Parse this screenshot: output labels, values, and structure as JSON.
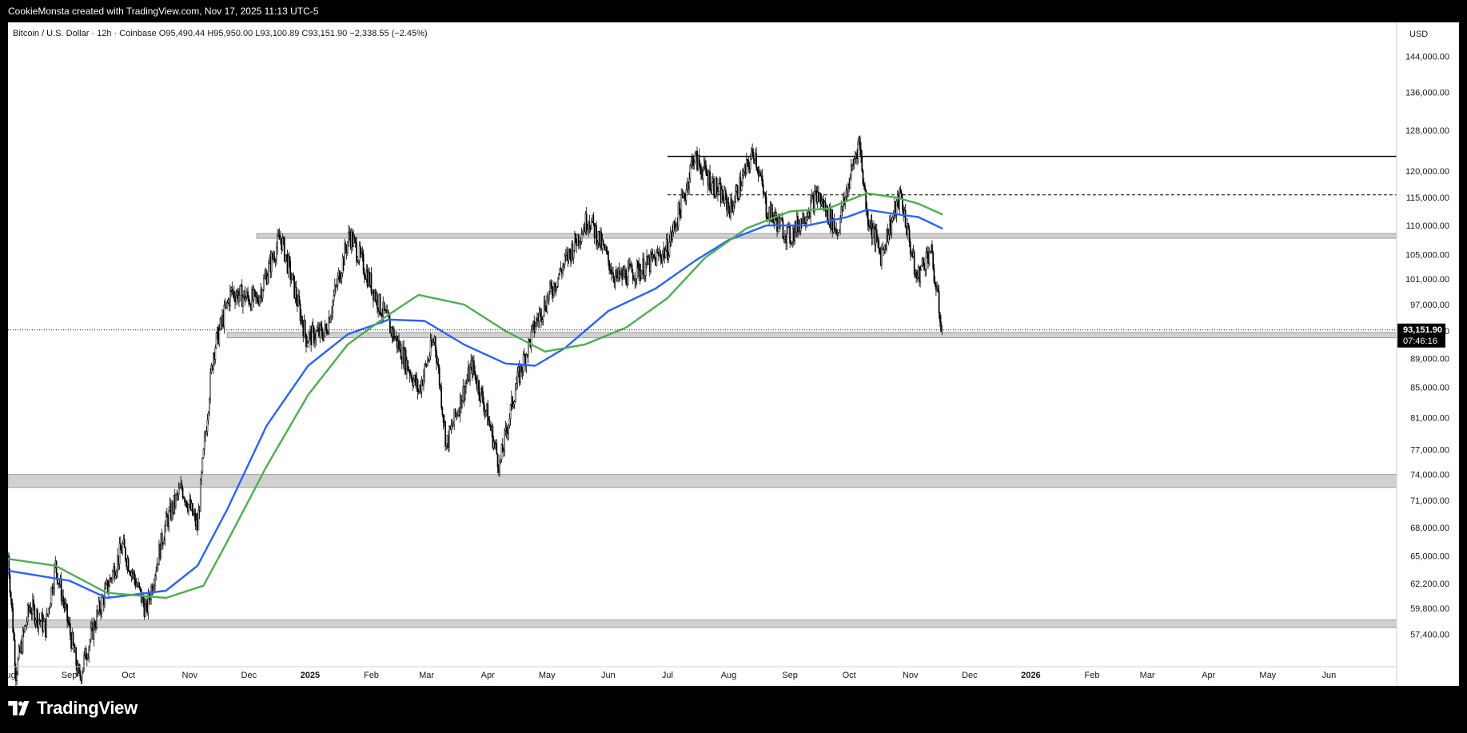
{
  "attribution": "CookieMonsta created with TradingView.com, Nov 17, 2025 11:13 UTC-5",
  "branding": {
    "logo_text": "TradingView",
    "logo_icon": "tradingview-logo-icon"
  },
  "chart_data": {
    "type": "candlestick",
    "symbol": "Bitcoin / U.S. Dollar",
    "interval": "12h",
    "exchange": "Coinbase",
    "ohlc_header": "Bitcoin / U.S. Dollar · 12h · Coinbase  O95,490.44  H95,950.00  L93,100.89  C93,151.90  −2,338.55 (−2.45%)",
    "open": 95490.44,
    "high": 95950.0,
    "low": 93100.89,
    "close": 93151.9,
    "change": -2338.55,
    "change_percent": -2.45,
    "currency_label": "USD",
    "price_axis": {
      "log_scale": true,
      "range": [
        54500,
        152000
      ],
      "ticks": [
        144000,
        136000,
        128000,
        120000,
        115000,
        110000,
        105000,
        101000,
        97000,
        93000,
        89000,
        85000,
        81000,
        77000,
        74000,
        71000,
        68000,
        65000,
        62200,
        59800,
        57400
      ],
      "tick_labels": [
        "144,000.00",
        "136,000.00",
        "128,000.00",
        "120,000.00",
        "115,000.00",
        "110,000.00",
        "105,000.00",
        "101,000.00",
        "97,000.00",
        "93,000.00",
        "89,000.00",
        "85,000.00",
        "81,000.00",
        "77,000.00",
        "74,000.00",
        "71,000.00",
        "68,000.00",
        "65,000.00",
        "62,200.00",
        "59,800.00",
        "57,400.00"
      ]
    },
    "time_axis": {
      "range": [
        "2024-08-01",
        "2026-06-30"
      ],
      "ticks": [
        {
          "date": "2024-08-01",
          "label": "Aug",
          "bold": false
        },
        {
          "date": "2024-09-01",
          "label": "Sep",
          "bold": false
        },
        {
          "date": "2024-10-01",
          "label": "Oct",
          "bold": false
        },
        {
          "date": "2024-11-01",
          "label": "Nov",
          "bold": false
        },
        {
          "date": "2024-12-01",
          "label": "Dec",
          "bold": false
        },
        {
          "date": "2025-01-01",
          "label": "2025",
          "bold": true
        },
        {
          "date": "2025-02-01",
          "label": "Feb",
          "bold": false
        },
        {
          "date": "2025-03-01",
          "label": "Mar",
          "bold": false
        },
        {
          "date": "2025-04-01",
          "label": "Apr",
          "bold": false
        },
        {
          "date": "2025-05-01",
          "label": "May",
          "bold": false
        },
        {
          "date": "2025-06-01",
          "label": "Jun",
          "bold": false
        },
        {
          "date": "2025-07-01",
          "label": "Jul",
          "bold": false
        },
        {
          "date": "2025-08-01",
          "label": "Aug",
          "bold": false
        },
        {
          "date": "2025-09-01",
          "label": "Sep",
          "bold": false
        },
        {
          "date": "2025-10-01",
          "label": "Oct",
          "bold": false
        },
        {
          "date": "2025-11-01",
          "label": "Nov",
          "bold": false
        },
        {
          "date": "2025-12-01",
          "label": "Dec",
          "bold": false
        },
        {
          "date": "2026-01-01",
          "label": "2026",
          "bold": true
        },
        {
          "date": "2026-02-01",
          "label": "Feb",
          "bold": false
        },
        {
          "date": "2026-03-01",
          "label": "Mar",
          "bold": false
        },
        {
          "date": "2026-04-01",
          "label": "Apr",
          "bold": false
        },
        {
          "date": "2026-05-01",
          "label": "May",
          "bold": false
        },
        {
          "date": "2026-06-01",
          "label": "Jun",
          "bold": false
        }
      ]
    },
    "current_price": {
      "value": 93151.9,
      "label": "93,151.90",
      "countdown": "07:46:16"
    },
    "price_path": [
      [
        "2024-08-01",
        65000
      ],
      [
        "2024-08-05",
        54000
      ],
      [
        "2024-08-12",
        60000
      ],
      [
        "2024-08-20",
        58000
      ],
      [
        "2024-08-25",
        64000
      ],
      [
        "2024-09-06",
        53500
      ],
      [
        "2024-09-15",
        59000
      ],
      [
        "2024-09-28",
        66000
      ],
      [
        "2024-10-10",
        59500
      ],
      [
        "2024-10-20",
        68500
      ],
      [
        "2024-10-28",
        72500
      ],
      [
        "2024-11-05",
        68000
      ],
      [
        "2024-11-13",
        90000
      ],
      [
        "2024-11-22",
        99000
      ],
      [
        "2024-12-05",
        97500
      ],
      [
        "2024-12-17",
        108000
      ],
      [
        "2024-12-30",
        92000
      ],
      [
        "2025-01-09",
        93000
      ],
      [
        "2025-01-21",
        108500
      ],
      [
        "2025-02-05",
        97000
      ],
      [
        "2025-02-25",
        84500
      ],
      [
        "2025-03-05",
        92000
      ],
      [
        "2025-03-11",
        77500
      ],
      [
        "2025-03-24",
        88000
      ],
      [
        "2025-03-31",
        82000
      ],
      [
        "2025-04-07",
        75000
      ],
      [
        "2025-04-15",
        85000
      ],
      [
        "2025-04-25",
        94000
      ],
      [
        "2025-05-09",
        103000
      ],
      [
        "2025-05-22",
        111500
      ],
      [
        "2025-06-05",
        101000
      ],
      [
        "2025-06-20",
        103000
      ],
      [
        "2025-07-01",
        106000
      ],
      [
        "2025-07-10",
        116000
      ],
      [
        "2025-07-14",
        122800
      ],
      [
        "2025-07-25",
        117000
      ],
      [
        "2025-08-02",
        113000
      ],
      [
        "2025-08-14",
        124000
      ],
      [
        "2025-08-20",
        113000
      ],
      [
        "2025-09-01",
        108000
      ],
      [
        "2025-09-15",
        115500
      ],
      [
        "2025-09-25",
        109000
      ],
      [
        "2025-10-01",
        118000
      ],
      [
        "2025-10-06",
        126000
      ],
      [
        "2025-10-10",
        112000
      ],
      [
        "2025-10-17",
        105000
      ],
      [
        "2025-10-27",
        115500
      ],
      [
        "2025-11-04",
        101000
      ],
      [
        "2025-11-11",
        106000
      ],
      [
        "2025-11-17",
        93151.9
      ]
    ],
    "indicators": [
      {
        "color": "#2962ff",
        "points": [
          [
            "2024-08-01",
            63500
          ],
          [
            "2024-09-01",
            62500
          ],
          [
            "2024-09-20",
            60800
          ],
          [
            "2024-10-20",
            61500
          ],
          [
            "2024-11-05",
            64000
          ],
          [
            "2024-11-20",
            70000
          ],
          [
            "2024-12-10",
            80000
          ],
          [
            "2024-12-31",
            88000
          ],
          [
            "2025-01-20",
            92500
          ],
          [
            "2025-02-10",
            94700
          ],
          [
            "2025-02-28",
            94500
          ],
          [
            "2025-03-20",
            91000
          ],
          [
            "2025-04-10",
            88300
          ],
          [
            "2025-04-25",
            88000
          ],
          [
            "2025-05-10",
            90500
          ],
          [
            "2025-06-01",
            96000
          ],
          [
            "2025-06-25",
            99500
          ],
          [
            "2025-07-15",
            104000
          ],
          [
            "2025-08-01",
            107500
          ],
          [
            "2025-08-20",
            110000
          ],
          [
            "2025-09-10",
            110000
          ],
          [
            "2025-09-30",
            111500
          ],
          [
            "2025-10-10",
            112800
          ],
          [
            "2025-10-25",
            112000
          ],
          [
            "2025-11-05",
            111500
          ],
          [
            "2025-11-17",
            109500
          ]
        ]
      },
      {
        "color": "#4caf50",
        "points": [
          [
            "2024-08-01",
            64700
          ],
          [
            "2024-08-25",
            64000
          ],
          [
            "2024-09-20",
            61300
          ],
          [
            "2024-10-20",
            60800
          ],
          [
            "2024-11-08",
            62000
          ],
          [
            "2024-11-20",
            66500
          ],
          [
            "2024-12-10",
            75000
          ],
          [
            "2024-12-31",
            84000
          ],
          [
            "2025-01-20",
            91000
          ],
          [
            "2025-02-10",
            95500
          ],
          [
            "2025-02-25",
            98500
          ],
          [
            "2025-03-20",
            97000
          ],
          [
            "2025-04-10",
            93000
          ],
          [
            "2025-04-30",
            90000
          ],
          [
            "2025-05-20",
            91000
          ],
          [
            "2025-06-10",
            93500
          ],
          [
            "2025-07-01",
            98000
          ],
          [
            "2025-07-20",
            104500
          ],
          [
            "2025-08-10",
            109500
          ],
          [
            "2025-09-01",
            112500
          ],
          [
            "2025-09-20",
            113000
          ],
          [
            "2025-10-10",
            115800
          ],
          [
            "2025-10-25",
            115000
          ],
          [
            "2025-11-05",
            113900
          ],
          [
            "2025-11-17",
            112000
          ]
        ]
      }
    ],
    "horizontal_levels": [
      {
        "kind": "line",
        "style": "solid",
        "price": 122800,
        "from": "2025-07-01"
      },
      {
        "kind": "line",
        "style": "dashed",
        "price": 115500,
        "from": "2025-07-01"
      },
      {
        "kind": "zone",
        "from_price": 107800,
        "to_price": 108600,
        "from": "2024-12-05"
      },
      {
        "kind": "zone",
        "from_price": 92000,
        "to_price": 92800,
        "from": "2024-11-20"
      },
      {
        "kind": "zone",
        "from_price": 72500,
        "to_price": 74000,
        "from": "2024-08-01"
      },
      {
        "kind": "zone",
        "from_price": 58000,
        "to_price": 58700,
        "from": "2024-08-01"
      }
    ],
    "colors": {
      "candles": "#000000",
      "zone_fill": "#d1d1d1",
      "zone_border": "#9e9e9e",
      "level_line": "#000000",
      "price_label_bg": "#000000",
      "axis_text": "#131722"
    }
  }
}
